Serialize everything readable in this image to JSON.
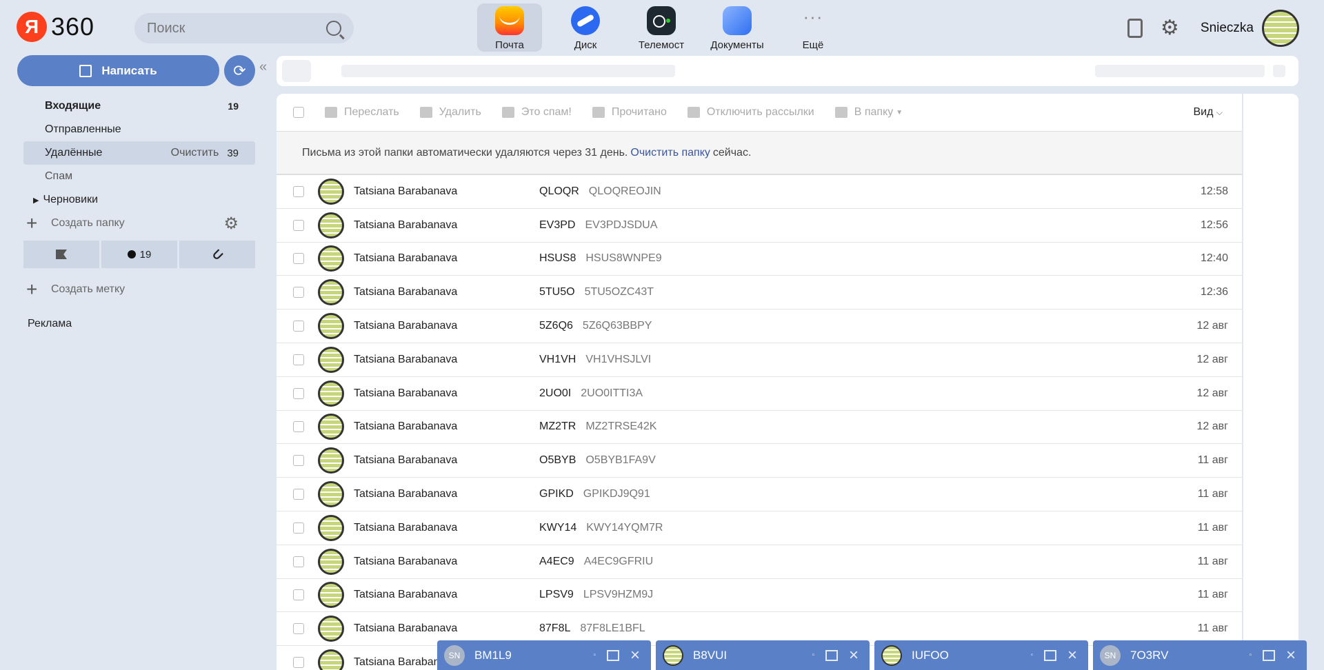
{
  "header": {
    "logo_letter": "Я",
    "logo_text": "360",
    "search_placeholder": "Поиск",
    "apps": [
      {
        "label": "Почта",
        "active": true
      },
      {
        "label": "Диск",
        "active": false
      },
      {
        "label": "Телемост",
        "active": false
      },
      {
        "label": "Документы",
        "active": false
      },
      {
        "label": "Ещё",
        "active": false
      }
    ],
    "username": "Snieczka"
  },
  "sidebar": {
    "compose_label": "Написать",
    "folders": [
      {
        "name": "Входящие",
        "count": "19"
      },
      {
        "name": "Отправленные",
        "count": ""
      },
      {
        "name": "Удалённые",
        "clear": "Очистить",
        "count": "39"
      },
      {
        "name": "Спам",
        "count": ""
      },
      {
        "name": "Черновики",
        "count": ""
      }
    ],
    "create_folder": "Создать папку",
    "filters": {
      "unread_count": "19"
    },
    "create_label": "Создать метку",
    "ads": "Реклама"
  },
  "toolbar": {
    "forward": "Переслать",
    "delete": "Удалить",
    "spam": "Это спам!",
    "read": "Прочитано",
    "unsubscribe": "Отключить рассылки",
    "to_folder": "В папку",
    "view": "Вид"
  },
  "notice": {
    "text": "Письма из этой папки автоматически удаляются через 31 день.",
    "link": "Очистить папку",
    "suffix": "сейчас."
  },
  "messages": [
    {
      "from": "Tatsiana Barabanava",
      "subject": "QLOQR",
      "preview": "QLOQREOJIN",
      "time": "12:58"
    },
    {
      "from": "Tatsiana Barabanava",
      "subject": "EV3PD",
      "preview": "EV3PDJSDUA",
      "time": "12:56"
    },
    {
      "from": "Tatsiana Barabanava",
      "subject": "HSUS8",
      "preview": "HSUS8WNPE9",
      "time": "12:40"
    },
    {
      "from": "Tatsiana Barabanava",
      "subject": "5TU5O",
      "preview": "5TU5OZC43T",
      "time": "12:36"
    },
    {
      "from": "Tatsiana Barabanava",
      "subject": "5Z6Q6",
      "preview": "5Z6Q63BBPY",
      "time": "12 авг"
    },
    {
      "from": "Tatsiana Barabanava",
      "subject": "VH1VH",
      "preview": "VH1VHSJLVI",
      "time": "12 авг"
    },
    {
      "from": "Tatsiana Barabanava",
      "subject": "2UO0I",
      "preview": "2UO0ITTI3A",
      "time": "12 авг"
    },
    {
      "from": "Tatsiana Barabanava",
      "subject": "MZ2TR",
      "preview": "MZ2TRSE42K",
      "time": "12 авг"
    },
    {
      "from": "Tatsiana Barabanava",
      "subject": "O5BYB",
      "preview": "O5BYB1FA9V",
      "time": "11 авг"
    },
    {
      "from": "Tatsiana Barabanava",
      "subject": "GPIKD",
      "preview": "GPIKDJ9Q91",
      "time": "11 авг"
    },
    {
      "from": "Tatsiana Barabanava",
      "subject": "KWY14",
      "preview": "KWY14YQM7R",
      "time": "11 авг"
    },
    {
      "from": "Tatsiana Barabanava",
      "subject": "A4EC9",
      "preview": "A4EC9GFRIU",
      "time": "11 авг"
    },
    {
      "from": "Tatsiana Barabanava",
      "subject": "LPSV9",
      "preview": "LPSV9HZM9J",
      "time": "11 авг"
    },
    {
      "from": "Tatsiana Barabanava",
      "subject": "87F8L",
      "preview": "87F8LE1BFL",
      "time": "11 авг"
    },
    {
      "from": "Tatsiana Barabanava",
      "subject": "",
      "preview": "",
      "time": ""
    }
  ],
  "compose_windows": [
    {
      "title": "BM1L9",
      "avatar": "SN",
      "image": false
    },
    {
      "title": "B8VUI",
      "avatar": "",
      "image": true
    },
    {
      "title": "IUFOO",
      "avatar": "",
      "image": true
    },
    {
      "title": "7O3RV",
      "avatar": "SN",
      "image": false
    }
  ]
}
